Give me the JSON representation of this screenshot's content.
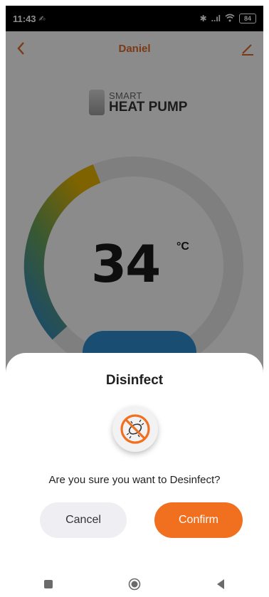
{
  "status_bar": {
    "time": "11:43",
    "signal_text": "..ıl",
    "battery_level": "84"
  },
  "app": {
    "title": "Daniel",
    "logo_line1": "SMART",
    "logo_line2": "HEAT PUMP",
    "temperature": "34",
    "temperature_unit": "°C"
  },
  "dialog": {
    "title": "Disinfect",
    "message": "Are you sure you want to Desinfect?",
    "cancel_label": "Cancel",
    "confirm_label": "Confirm"
  },
  "colors": {
    "accent": "#f07020",
    "title": "#e06b2a",
    "power_button": "#2e8fd0"
  },
  "icons": [
    "back-icon",
    "edit-icon",
    "disinfect-icon",
    "square-nav-icon",
    "circle-nav-icon",
    "triangle-back-nav-icon"
  ]
}
